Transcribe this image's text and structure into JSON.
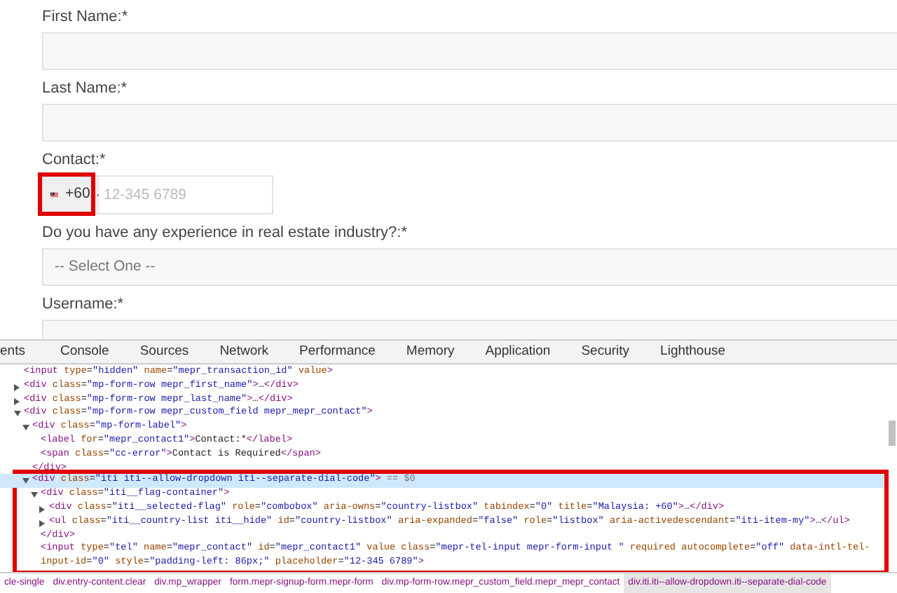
{
  "form": {
    "fields": [
      {
        "kind": "text",
        "label": "First Name:*"
      },
      {
        "kind": "text",
        "label": "Last Name:*"
      },
      {
        "kind": "phone",
        "label": "Contact:*",
        "dial_code": "+60",
        "placeholder": "12-345 6789",
        "highlighted": true
      },
      {
        "kind": "select",
        "label": "Do you have any experience in real estate industry?:*",
        "value": "-- Select One --"
      },
      {
        "kind": "text",
        "label": "Username:*"
      }
    ]
  },
  "devtools": {
    "tabs": [
      "ents",
      "Console",
      "Sources",
      "Network",
      "Performance",
      "Memory",
      "Application",
      "Security",
      "Lighthouse"
    ],
    "tree": [
      {
        "text": "<input type=\"hidden\" name=\"mepr_transaction_id\" value>",
        "selected": false
      },
      {
        "text": "<div class=\"mp-form-row mepr_first_name\">…</div>",
        "expanded": false,
        "selected": false
      },
      {
        "text": "<div class=\"mp-form-row mepr_last_name\">…</div>",
        "expanded": false,
        "selected": false
      },
      {
        "text": "<div class=\"mp-form-row mepr_custom_field mepr_mepr_contact\">",
        "expanded": true,
        "selected": false,
        "children": [
          {
            "text": "<div class=\"mp-form-label\">",
            "expanded": true,
            "selected": false,
            "close": "</div>",
            "children": [
              {
                "text": "<label for=\"mepr_contact1\">Contact:*</label>",
                "selected": false
              },
              {
                "text": "<span class=\"cc-error\">Contact is Required</span>",
                "selected": false
              }
            ]
          },
          {
            "text": "<div class=\"iti iti--allow-dropdown iti--separate-dial-code\">",
            "expanded": true,
            "selected": true,
            "console_ref": "== $0",
            "highlighted": true,
            "children": [
              {
                "text": "<div class=\"iti__flag-container\">",
                "expanded": true,
                "selected": false,
                "close": "</div>",
                "children": [
                  {
                    "text": "<div class=\"iti__selected-flag\" role=\"combobox\" aria-owns=\"country-listbox\" tabindex=\"0\" title=\"Malaysia: +60\">…</div>",
                    "expanded": false,
                    "selected": false
                  },
                  {
                    "text": "<ul class=\"iti__country-list iti__hide\" id=\"country-listbox\" aria-expanded=\"false\" role=\"listbox\" aria-activedescendant=\"iti-item-my\">…</ul>",
                    "expanded": false,
                    "selected": false
                  }
                ]
              },
              {
                "text": "<input type=\"tel\" name=\"mepr_contact\" id=\"mepr_contact1\" value class=\"mepr-tel-input mepr-form-input \" required autocomplete=\"off\" data-intl-tel-input-id=\"0\" style=\"padding-left: 86px;\" placeholder=\"12-345 6789\">",
                "selected": false
              }
            ]
          }
        ]
      }
    ],
    "breadcrumbs": [
      {
        "label": "cle-single",
        "selected": false
      },
      {
        "label": "div.entry-content.clear",
        "selected": false
      },
      {
        "label": "div.mp_wrapper",
        "selected": false
      },
      {
        "label": "form.mepr-signup-form.mepr-form",
        "selected": false
      },
      {
        "label": "div.mp-form-row.mepr_custom_field.mepr_mepr_contact",
        "selected": false
      },
      {
        "label": "div.iti.iti--allow-dropdown.iti--separate-dial-code",
        "selected": true
      }
    ]
  }
}
